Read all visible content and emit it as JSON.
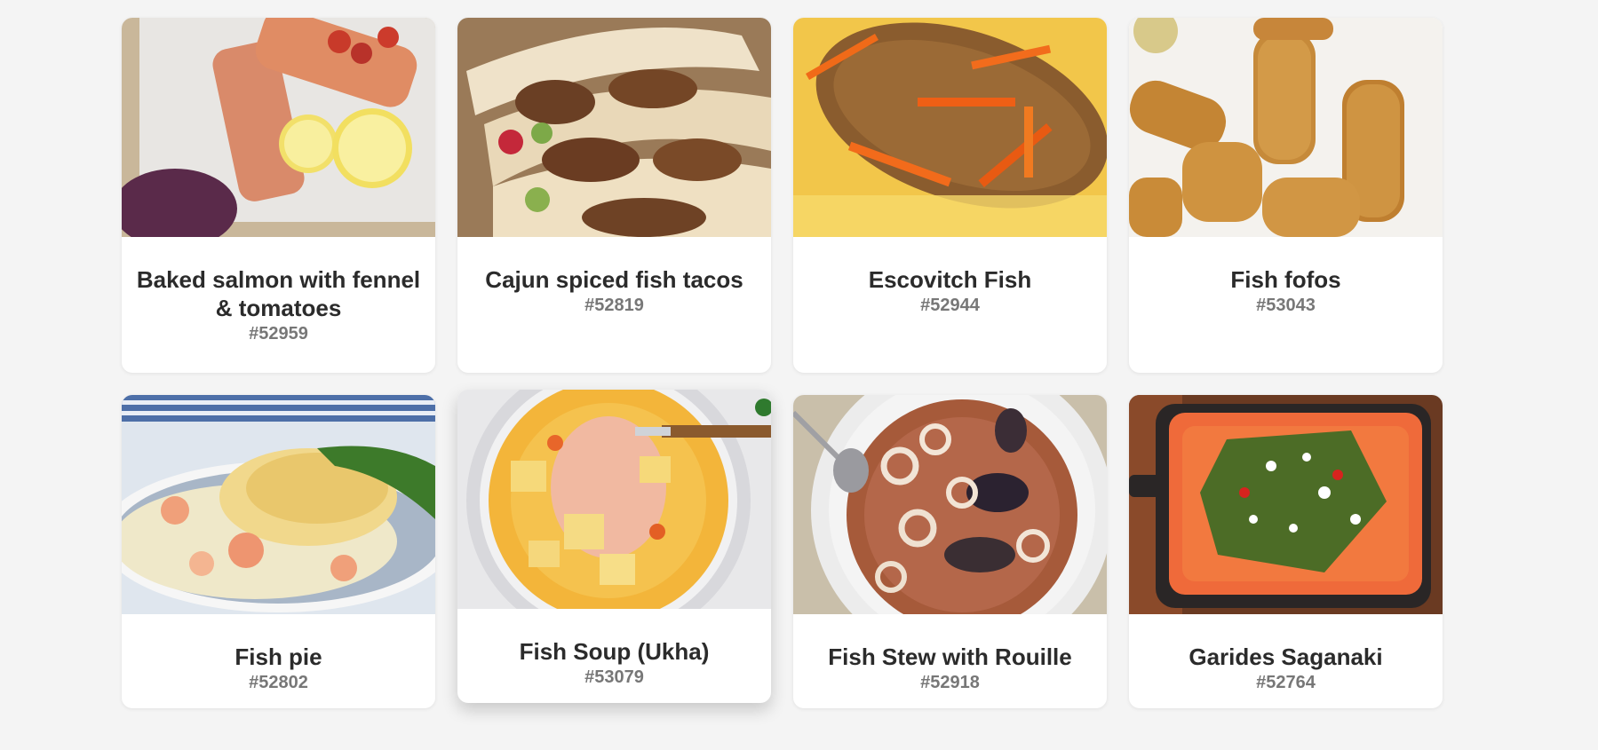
{
  "recipes": [
    {
      "title": "Baked salmon with fennel & tomatoes",
      "id": "#52959",
      "image": "baked-salmon-photo"
    },
    {
      "title": "Cajun spiced fish tacos",
      "id": "#52819",
      "image": "fish-tacos-photo"
    },
    {
      "title": "Escovitch Fish",
      "id": "#52944",
      "image": "escovitch-fish-photo"
    },
    {
      "title": "Fish fofos",
      "id": "#53043",
      "image": "fish-fofos-photo"
    },
    {
      "title": "Fish pie",
      "id": "#52802",
      "image": "fish-pie-photo"
    },
    {
      "title": "Fish Soup (Ukha)",
      "id": "#53079",
      "image": "fish-soup-photo"
    },
    {
      "title": "Fish Stew with Rouille",
      "id": "#52918",
      "image": "fish-stew-photo"
    },
    {
      "title": "Garides Saganaki",
      "id": "#52764",
      "image": "garides-saganaki-photo"
    }
  ]
}
